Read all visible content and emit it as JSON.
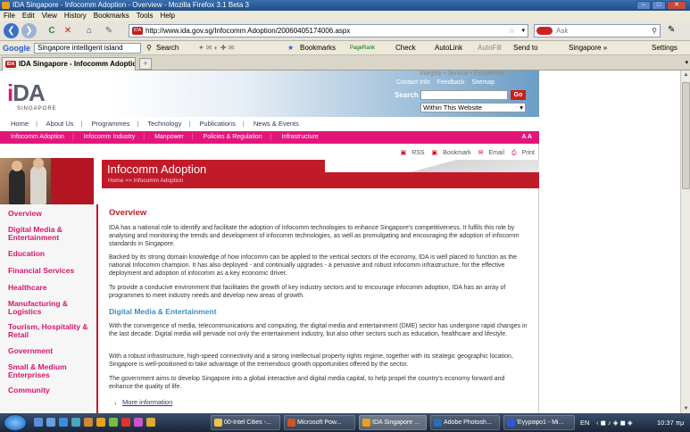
{
  "window": {
    "title": "IDA Singapore - Infocomm Adoption - Overview - Mozilla Firefox 3.1 Beta 3",
    "min": "–",
    "max": "□",
    "close": "✕"
  },
  "menu": [
    "File",
    "Edit",
    "View",
    "History",
    "Bookmarks",
    "Tools",
    "Help"
  ],
  "nav": {
    "url": "http://www.ida.gov.sg/Infocomm Adoption/20060405174006.aspx",
    "site_icon": "IDA",
    "ask_placeholder": "Ask",
    "back": "❮",
    "forward": "❯",
    "reload": "C",
    "stop": "✕",
    "home": "⌂",
    "dropdown": "▾",
    "star": "☆",
    "search_glyph": "⚲"
  },
  "toolbar": {
    "google": "Google",
    "search_value": "Singapore intelligent island",
    "search_label": "Search",
    "bookmarks": "Bookmarks",
    "pagerank": "PageRank",
    "check": "Check",
    "autolink": "AutoLink",
    "autofill": "AutoFill",
    "sendto": "Send to",
    "singapore": "Singapore »",
    "settings": "Settings"
  },
  "tab": {
    "label": "IDA Singapore - Infocomm Adoption ...",
    "new_tab": "+",
    "list": "▾"
  },
  "site": {
    "top_strip": "Integrity • Service • Excellence",
    "logo_mark": "i",
    "logo_rest": "DA",
    "logo_sub": "SINGAPORE",
    "toplinks": [
      "Contact Info",
      "Feedback",
      "Sitemap"
    ],
    "search_label": "Search",
    "go": "Go",
    "within": "Within This Website",
    "main_nav": [
      "Home",
      "About Us",
      "Programmes",
      "Technology",
      "Publications",
      "News & Events"
    ],
    "pink_nav": [
      "Infocomm Adoption",
      "Infocomm Industry",
      "Manpower",
      "Policies & Regulation",
      "Infrastructure"
    ],
    "text_size": "A  A",
    "utils": [
      "RSS",
      "Bookmark",
      "Email",
      "Print"
    ],
    "banner_title": "Infocomm Adoption",
    "breadcrumb": "Home >> Infocomm Adoption",
    "sidenav": [
      "Overview",
      "Digital Media & Entertainment",
      "Education",
      "Financial Services",
      "Healthcare",
      "Manufacturing & Logistics",
      "Tourism, Hospitality & Retail",
      "Government",
      "Small & Medium Enterprises",
      "Community"
    ],
    "heading": "Overview",
    "paragraphs": [
      "IDA has a national role to identify and facilitate the adoption of infocomm technologies to enhance Singapore's competitiveness. It fulfils this role by analysing and monitoring the trends and development of infocomm technologies, as well as promulgating and encouraging the adoption of infocomm standards in Singapore.",
      "Backed by its strong domain knowledge of how infocomm can be applied to the vertical sectors of the economy, IDA is well placed to function as the national Infocomm champion. It has also deployed - and continually upgrades - a pervasive and robust infocomm infrastructure, for the effective deployment and adoption of infocomm as a key economic driver.",
      "To provide a conducive environment that facilitates the growth of key industry sectors and to encourage infocomm adoption, IDA has an array of programmes to meet industry needs and develop new areas of growth."
    ],
    "subheading": "Digital Media & Entertainment",
    "dme_paragraphs": [
      "With the convergence of media, telecommunications and computing, the digital media and entertainment (DME) sector has undergone rapid changes in the last decade. Digital media will pervade not only the entertainment industry, but also other sectors such as education, healthcare and lifestyle.",
      "With a robust infrastructure, high-speed connectivity and a strong intellectual property rights regime, together with its strategic geographic location, Singapore is well-positioned to take advantage of the tremendous growth opportunities offered by the sector.",
      "The government aims to develop Singapore into a global interactive and digital media capital, to help propel the country's economy forward and enhance the quality of life."
    ],
    "more": "More information",
    "bullet": "›"
  },
  "taskbar": {
    "buttons": [
      "00-Intel Cities -...",
      "Microsoft Pow...",
      "IDA Singapore ...",
      "Adobe Photosh...",
      "Έγγραφο1 - Mi..."
    ],
    "lang": "EN",
    "clock": "10:37 πμ"
  }
}
